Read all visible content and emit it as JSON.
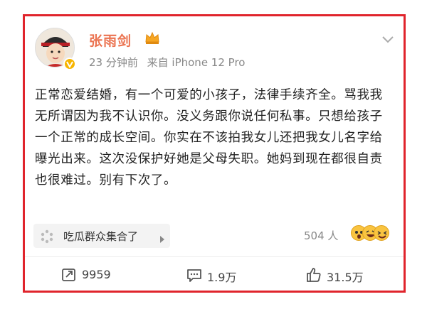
{
  "post": {
    "author": "张雨剑",
    "time": "23 分钟前",
    "source": "来自 iPhone 12 Pro",
    "content": "正常恋爱结婚，有一个可爱的小孩子，法律手续齐全。骂我我无所谓因为我不认识你。没义务跟你说任何私事。只想给孩子一个正常的成长空间。你实在不该拍我女儿还把我女儿名字给曝光出来。这次没保护好她是父母失职。她妈到现在都很自责也很难过。别有下次了。"
  },
  "topic": {
    "label": "吃瓜群众集合了",
    "readers": "504 人"
  },
  "actions": {
    "repost": "9959",
    "comments": "1.9万",
    "likes": "31.5万"
  },
  "colors": {
    "frame": "#e0242c",
    "name": "#eb7350",
    "meta": "#888888"
  }
}
